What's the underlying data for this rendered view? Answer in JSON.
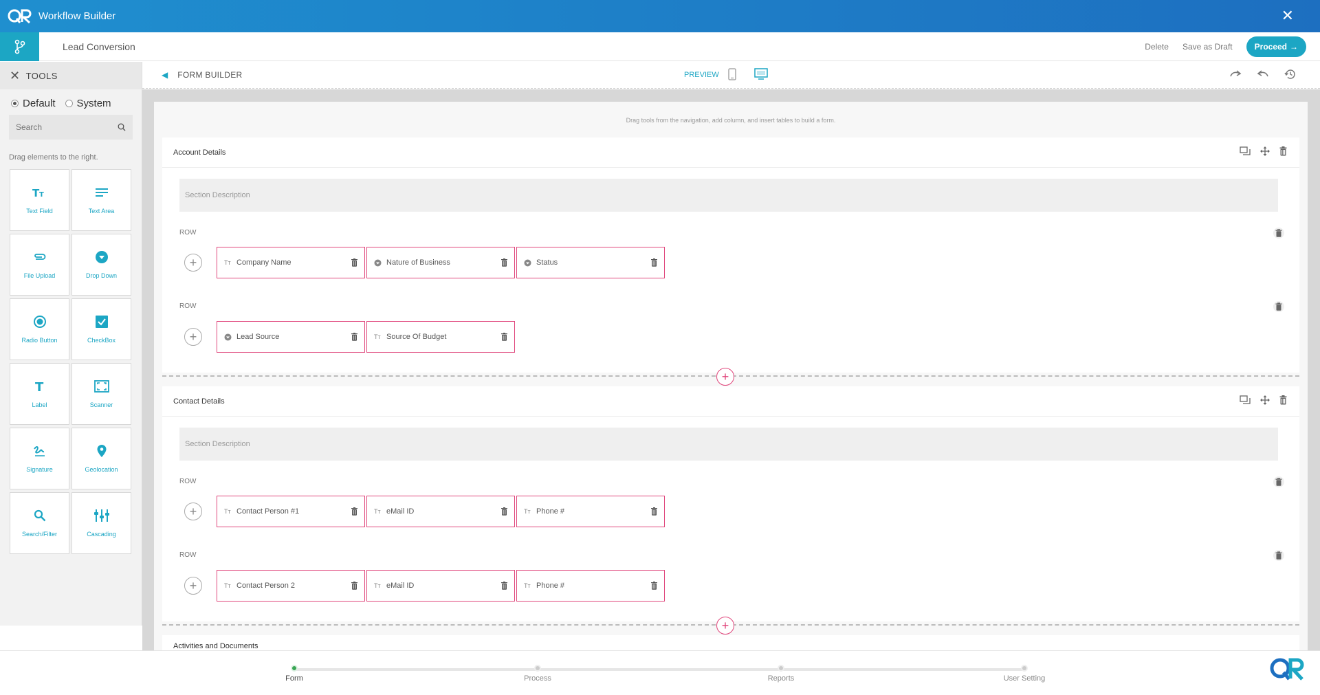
{
  "app": {
    "title": "Workflow Builder"
  },
  "workflow": {
    "name": "Lead Conversion",
    "actions": {
      "delete": "Delete",
      "save_draft": "Save as Draft",
      "proceed": "Proceed"
    }
  },
  "tools_panel": {
    "title": "TOOLS",
    "modes": [
      "Default",
      "System"
    ],
    "selected_mode": "Default",
    "search_placeholder": "Search",
    "hint": "Drag elements to the right.",
    "items": [
      {
        "label": "Text Field",
        "icon": "text-field-icon"
      },
      {
        "label": "Text Area",
        "icon": "text-area-icon"
      },
      {
        "label": "File Upload",
        "icon": "paperclip-icon"
      },
      {
        "label": "Drop Down",
        "icon": "dropdown-icon"
      },
      {
        "label": "Radio Button",
        "icon": "radio-icon"
      },
      {
        "label": "CheckBox",
        "icon": "checkbox-icon"
      },
      {
        "label": "Label",
        "icon": "label-icon"
      },
      {
        "label": "Scanner",
        "icon": "scanner-icon"
      },
      {
        "label": "Signature",
        "icon": "signature-icon"
      },
      {
        "label": "Geolocation",
        "icon": "pin-icon"
      },
      {
        "label": "Search/Filter",
        "icon": "search-icon"
      },
      {
        "label": "Cascading",
        "icon": "cascading-icon"
      }
    ]
  },
  "form_builder": {
    "title": "FORM BUILDER",
    "preview": "PREVIEW",
    "drag_hint": "Drag tools from the navigation, add column, and insert tables to build a form.",
    "row_label": "ROW",
    "sections": [
      {
        "title": "Account Details",
        "description_placeholder": "Section Description",
        "rows": [
          [
            {
              "label": "Company Name",
              "type": "text"
            },
            {
              "label": "Nature of Business",
              "type": "dropdown"
            },
            {
              "label": "Status",
              "type": "dropdown"
            }
          ],
          [
            {
              "label": "Lead Source",
              "type": "dropdown"
            },
            {
              "label": "Source Of Budget",
              "type": "text"
            }
          ]
        ]
      },
      {
        "title": "Contact Details",
        "description_placeholder": "Section Description",
        "rows": [
          [
            {
              "label": "Contact Person #1",
              "type": "text"
            },
            {
              "label": "eMail ID",
              "type": "text"
            },
            {
              "label": "Phone #",
              "type": "text"
            }
          ],
          [
            {
              "label": "Contact Person 2",
              "type": "text"
            },
            {
              "label": "eMail ID",
              "type": "text"
            },
            {
              "label": "Phone #",
              "type": "text"
            }
          ]
        ]
      },
      {
        "title": "Activities and Documents"
      }
    ]
  },
  "steps": [
    {
      "label": "Form",
      "active": true
    },
    {
      "label": "Process",
      "active": false
    },
    {
      "label": "Reports",
      "active": false
    },
    {
      "label": "User Setting",
      "active": false
    }
  ],
  "colors": {
    "accent": "#1ca6c4",
    "field_border": "#e0457b",
    "title_bar": "#1d6fc0",
    "active_step": "#3aa655"
  }
}
